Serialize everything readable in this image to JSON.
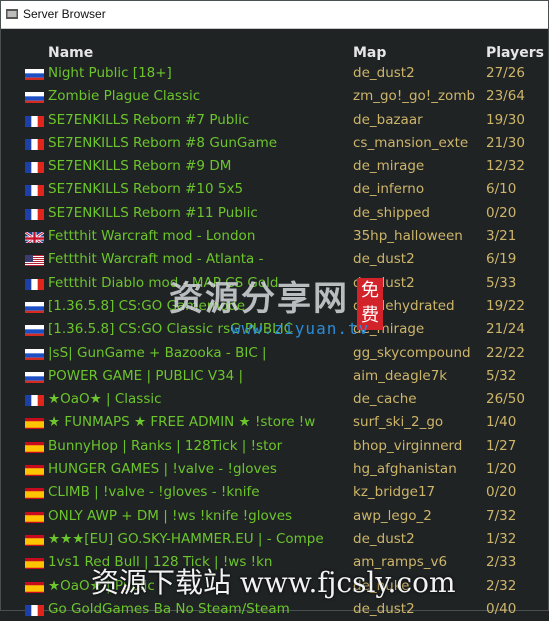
{
  "window": {
    "title": "Server Browser"
  },
  "columns": {
    "name": "Name",
    "map": "Map",
    "players": "Players"
  },
  "rows": [
    {
      "flag": "ru",
      "name": "Night Public [18+]",
      "map": "de_dust2",
      "players": "27/26"
    },
    {
      "flag": "ru",
      "name": "Zombie Plague Classic",
      "map": "zm_go!_go!_zomb",
      "players": "23/64"
    },
    {
      "flag": "fr",
      "name": "SE7ENKILLS Reborn #7 Public",
      "map": "de_bazaar",
      "players": "19/30"
    },
    {
      "flag": "fr",
      "name": "SE7ENKILLS Reborn #8 GunGame",
      "map": "cs_mansion_exte",
      "players": "21/30"
    },
    {
      "flag": "fr",
      "name": "SE7ENKILLS Reborn #9 DM",
      "map": "de_mirage",
      "players": "12/32"
    },
    {
      "flag": "fr",
      "name": "SE7ENKILLS Reborn #10 5x5",
      "map": "de_inferno",
      "players": "6/10"
    },
    {
      "flag": "fr",
      "name": "SE7ENKILLS Reborn #11 Public",
      "map": "de_shipped",
      "players": "0/20"
    },
    {
      "flag": "gb",
      "name": "Fettthit Warcraft mod - London",
      "map": "35hp_halloween",
      "players": "3/21"
    },
    {
      "flag": "us",
      "name": "Fettthit Warcraft mod - Atlanta -",
      "map": "de_dust2",
      "players": "6/19"
    },
    {
      "flag": "fr",
      "name": "Fettthit Diablo mod - MAP CS Gold",
      "map": "de_dust2",
      "players": "5/33"
    },
    {
      "flag": "ru",
      "name": "[1.36.5.8] CS:GO Gamemode",
      "map": "de_dehydrated",
      "players": "19/22"
    },
    {
      "flag": "ru",
      "name": "[1.36.5.8] CS:GO Classic rsG PUBLIC",
      "map": "de_mirage",
      "players": "21/24"
    },
    {
      "flag": "ru",
      "name": "|sS| GunGame + Bazooka - BIC |",
      "map": "gg_skycompound",
      "players": "22/22"
    },
    {
      "flag": "ru",
      "name": "POWER GAME | PUBLIC V34 |",
      "map": "aim_deagle7k",
      "players": "5/32"
    },
    {
      "flag": "fr",
      "name": "★OaO★ | Classic",
      "map": "de_cache",
      "players": "26/50"
    },
    {
      "flag": "es",
      "name": "★ FUNMAPS ★ FREE ADMIN ★ !store !w",
      "map": "surf_ski_2_go",
      "players": "1/40"
    },
    {
      "flag": "es",
      "name": "BunnyHop | Ranks | 128Tick | !stor",
      "map": "bhop_virginnerd",
      "players": "1/27"
    },
    {
      "flag": "es",
      "name": "HUNGER GAMES | !valve - !gloves",
      "map": "hg_afghanistan",
      "players": "1/20"
    },
    {
      "flag": "es",
      "name": "CLIMB | !valve - !gloves - !knife",
      "map": "kz_bridge17",
      "players": "0/20"
    },
    {
      "flag": "es",
      "name": "ONLY AWP + DM | !ws !knife !gloves",
      "map": "awp_lego_2",
      "players": "7/32"
    },
    {
      "flag": "es",
      "name": "★★★[EU] GO.SKY-HAMMER.EU | - Compe",
      "map": "de_dust2",
      "players": "1/32"
    },
    {
      "flag": "es",
      "name": "1vs1 Red Bull | 128 Tick | !ws !kn",
      "map": "am_ramps_v6",
      "players": "2/33"
    },
    {
      "flag": "es",
      "name": "★OaO★ | Public",
      "map": "de_nuke",
      "players": "2/32"
    },
    {
      "flag": "fr",
      "name": "Go GoldGames Ba No Steam/Steam",
      "map": "de_dust2",
      "players": "0/40"
    }
  ],
  "watermarks": {
    "center": "资源分享网",
    "center_badge": "免费",
    "center_sub": "www.ziyuan.tv",
    "bottom": "资源下载站  www.fjcsly.com"
  },
  "colors": {
    "name_text": "#6cc52c",
    "map_text": "#cdb56a",
    "background": "#1f2324"
  }
}
